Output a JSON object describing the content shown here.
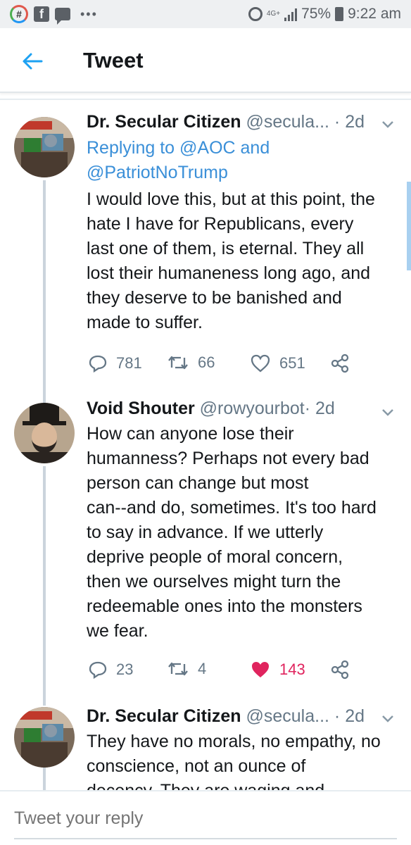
{
  "status_bar": {
    "network": "4G+",
    "battery": "75%",
    "time": "9:22 am",
    "notification_icons": [
      "hashtag-app-icon",
      "facebook-icon",
      "message-icon"
    ],
    "more": "•••"
  },
  "header": {
    "title": "Tweet",
    "back_icon": "arrow-left-icon"
  },
  "colors": {
    "accent": "#1da1f2",
    "link": "#3a8fd8",
    "like": "#e0245e",
    "muted": "#657786"
  },
  "tweets": [
    {
      "name": "Dr. Secular Citizen",
      "handle": "@secula...",
      "dot": "·",
      "age": "2d",
      "reply_label": "Replying to",
      "reply_to": "@AOC and",
      "reply_to_2": "@PatriotNoTrump",
      "text": "I would love this, but at this point, the\nhate I have for Republicans, every\nlast one of them, is eternal. They all\nlost their humaneness long ago, and\nthey deserve to be banished and\nmade to suffer.",
      "replies": "781",
      "retweets": "66",
      "likes": "651",
      "liked": false
    },
    {
      "name": "Void Shouter",
      "handle": "@rowyourbot",
      "dot": "·",
      "age": "2d",
      "text": "How can anyone lose their\nhumanness?  Perhaps not every bad\nperson can change but most\ncan--and do, sometimes. It's too hard\nto say in advance. If we utterly\ndeprive people of moral concern,\nthen we ourselves might turn the\nredeemable ones into the monsters\nwe fear.",
      "replies": "23",
      "retweets": "4",
      "likes": "143",
      "liked": true
    },
    {
      "name": "Dr. Secular Citizen",
      "handle": "@secula...",
      "dot": "·",
      "age": "2d",
      "text": "They have no morals, no empathy, no\nconscience, not an ounce of\ndecency. They are waging and"
    }
  ],
  "reply_bar": {
    "placeholder": "Tweet your reply"
  }
}
